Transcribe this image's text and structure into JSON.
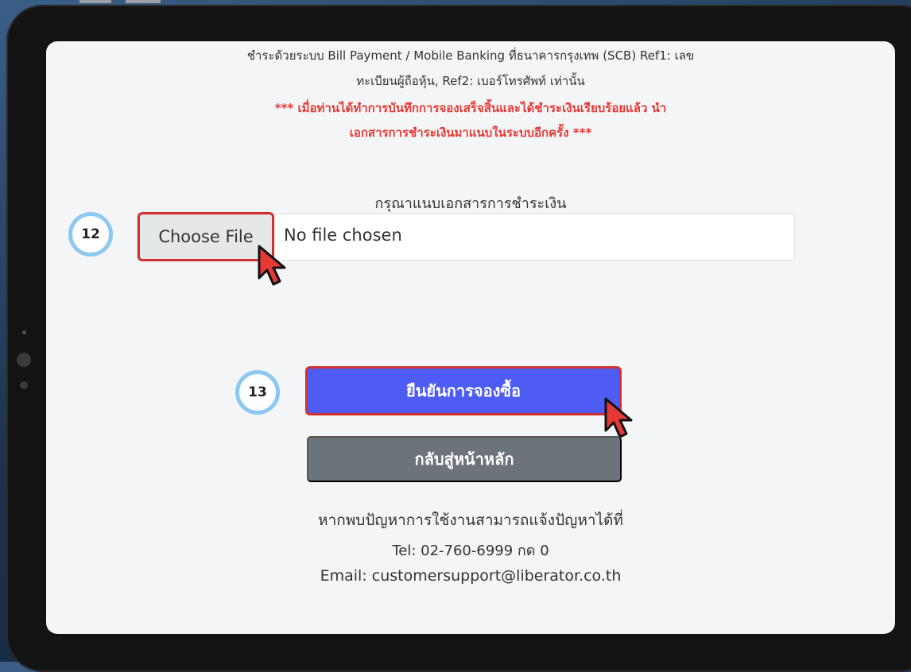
{
  "payment_info": {
    "line1": "ชำระด้วยระบบ Bill Payment / Mobile Banking ที่ธนาคารกรุงเทพ (SCB) Ref1: เลข",
    "line2": "ทะเบียนผู้ถือหุ้น, Ref2: เบอร์โทรศัพท์ เท่านั้น",
    "warning_line1": "*** เมื่อท่านได้ทำการบันทึกการจองเสร็จสิ้นและได้ชำระเงินเรียบร้อยแล้ว นำ",
    "warning_line2": "เอกสารการชำระเงินมาแนบในระบบอีกครั้ง ***"
  },
  "upload": {
    "label": "กรุณาแนบเอกสารการชำระเงิน",
    "choose_file_label": "Choose File",
    "no_file_text": "No file chosen",
    "step_number": "12"
  },
  "actions": {
    "confirm_label": "ยืนยันการจองซื้อ",
    "confirm_step_number": "13",
    "home_label": "กลับสู่หน้าหลัก"
  },
  "help": {
    "text": "หากพบปัญหาการใช้งานสามารถแจ้งปัญหาได้ที่",
    "tel_label": "Tel:",
    "tel_value": "02-760-6999 กด 0",
    "email_text": "Email: customersupport@liberator.co.th"
  },
  "colors": {
    "highlight_border": "#d32f2f",
    "confirm_bg": "#4f5cf3",
    "home_bg": "#6c737b",
    "warning_text": "#e53935",
    "badge_ring": "#8cc8f2"
  }
}
